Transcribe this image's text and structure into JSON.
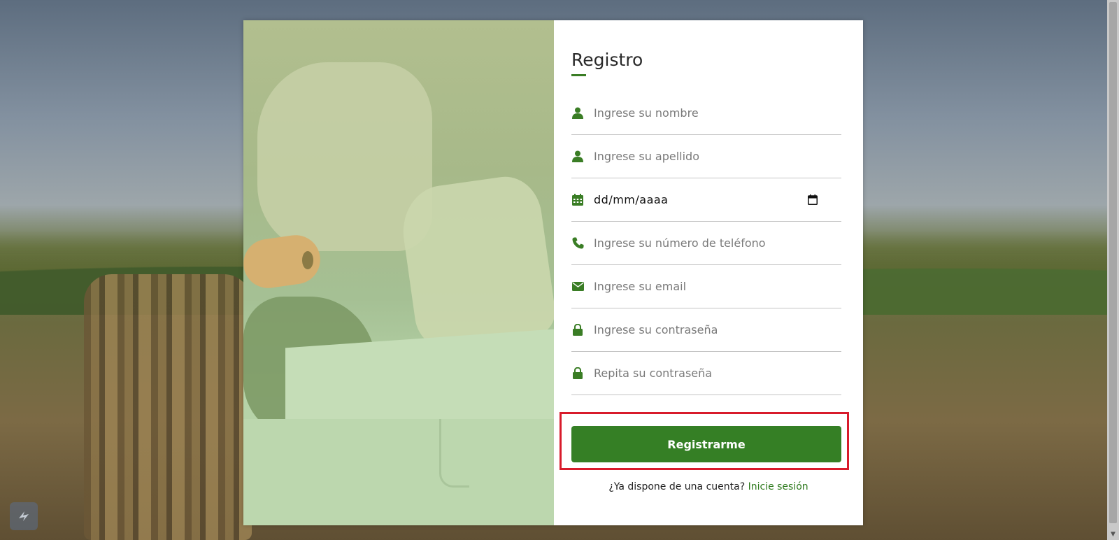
{
  "colors": {
    "accent": "#357f25",
    "icon": "#3a7d25",
    "highlight": "#d81b2b",
    "link": "#2e7a1d"
  },
  "form": {
    "title": "Registro",
    "fields": [
      {
        "icon": "user-icon",
        "type": "text",
        "placeholder": "Ingrese su nombre"
      },
      {
        "icon": "user-icon",
        "type": "text",
        "placeholder": "Ingrese su apellido"
      },
      {
        "icon": "calendar-icon",
        "type": "date",
        "display": "dd/mm/aaaa"
      },
      {
        "icon": "phone-icon",
        "type": "tel",
        "placeholder": "Ingrese su número de teléfono"
      },
      {
        "icon": "envelope-icon",
        "type": "email",
        "placeholder": "Ingrese su email"
      },
      {
        "icon": "lock-icon",
        "type": "password",
        "placeholder": "Ingrese su contraseña"
      },
      {
        "icon": "lock-icon",
        "type": "password",
        "placeholder": "Repita su contraseña"
      }
    ],
    "submit_label": "Registrarme",
    "login_prompt": "¿Ya dispone de una cuenta?",
    "login_link": "Inicie sesión"
  }
}
